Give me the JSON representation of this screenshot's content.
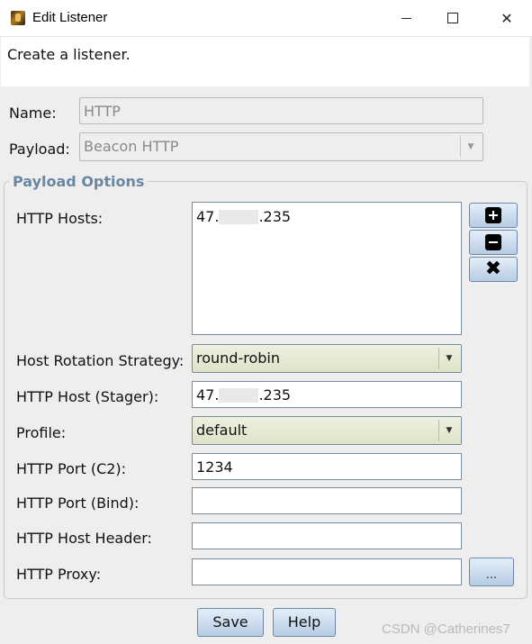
{
  "window": {
    "title": "Edit Listener",
    "description": "Create a listener."
  },
  "form": {
    "name_label": "Name:",
    "name_value": "HTTP",
    "payload_label": "Payload:",
    "payload_value": "Beacon HTTP"
  },
  "payload_options": {
    "group_title": "Payload Options",
    "http_hosts_label": "HTTP Hosts:",
    "http_hosts": [
      {
        "prefix": "47.",
        "suffix": ".235"
      }
    ],
    "host_rotation_label": "Host Rotation Strategy:",
    "host_rotation_value": "round-robin",
    "host_stager_label": "HTTP Host (Stager):",
    "host_stager_prefix": "47.",
    "host_stager_suffix": ".235",
    "profile_label": "Profile:",
    "profile_value": "default",
    "port_c2_label": "HTTP Port (C2):",
    "port_c2_value": "1234",
    "port_bind_label": "HTTP Port (Bind):",
    "port_bind_value": "",
    "host_header_label": "HTTP Host Header:",
    "host_header_value": "",
    "proxy_label": "HTTP Proxy:",
    "proxy_value": "",
    "proxy_button": "..."
  },
  "host_buttons": {
    "add_icon": "plus-square-icon",
    "remove_icon": "minus-square-icon",
    "clear_icon": "x-icon"
  },
  "footer": {
    "save_label": "Save",
    "help_label": "Help"
  },
  "watermark": "CSDN @Catherines7"
}
